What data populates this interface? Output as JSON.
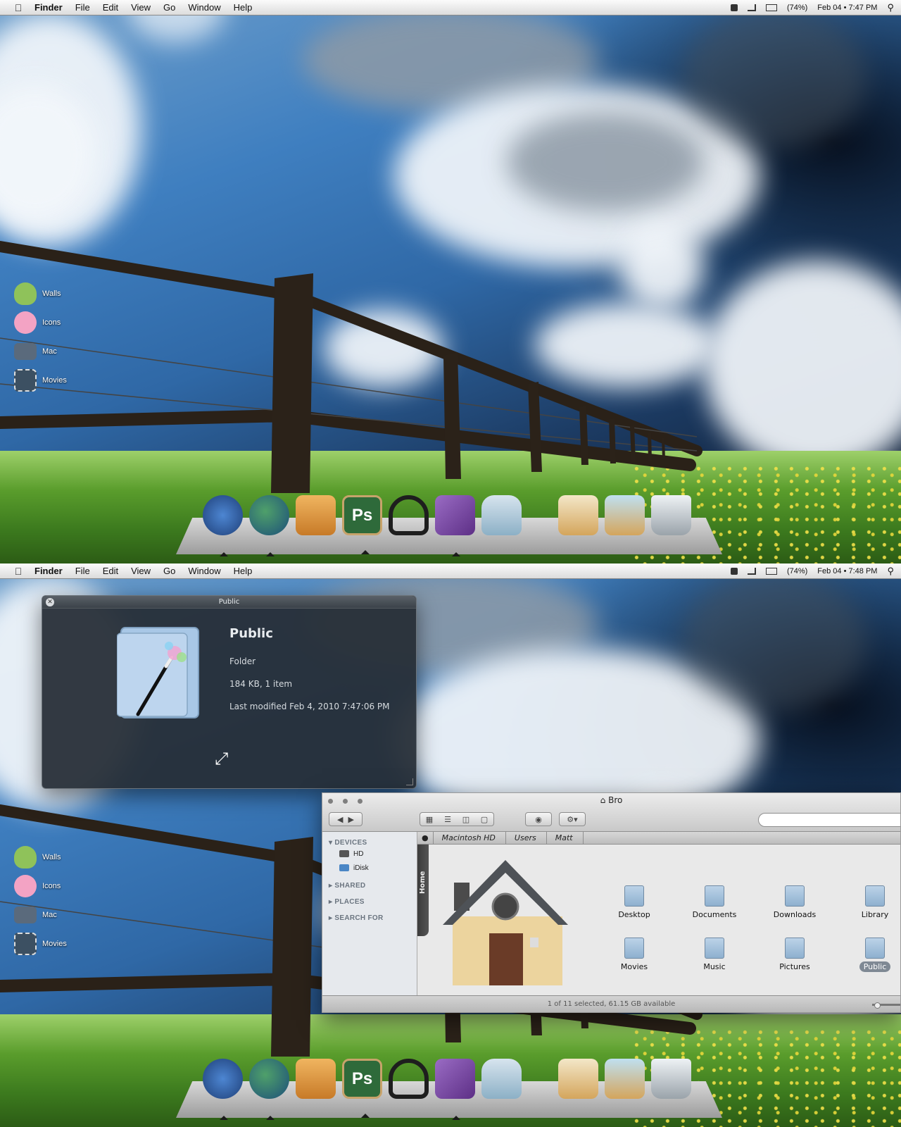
{
  "menubar": {
    "apple_glyph": "",
    "app": "Finder",
    "items": [
      "File",
      "Edit",
      "View",
      "Go",
      "Window",
      "Help"
    ],
    "battery": "(74%)",
    "clock_top": "Feb 04 • 7:47 PM",
    "clock_bottom": "Feb 04 • 7:48 PM"
  },
  "desktop_icons": [
    {
      "label": "Walls",
      "color": "#8fc25a"
    },
    {
      "label": "Icons",
      "color": "#f3a3c4"
    },
    {
      "label": "Mac",
      "color": "#5a6a7c"
    },
    {
      "label": "Movies",
      "color": "#3c5062"
    }
  ],
  "dock": {
    "items": [
      {
        "name": "radar-icon",
        "glyph": "",
        "color": "#2f5fa8",
        "running": true
      },
      {
        "name": "globe-icon",
        "glyph": "",
        "color": "#2f7d4a",
        "running": true
      },
      {
        "name": "ichat-icon",
        "glyph": "",
        "color": "#d98a32",
        "running": false
      },
      {
        "name": "photoshop-icon",
        "glyph": "Ps",
        "color": "#2e6a3a",
        "running": true
      },
      {
        "name": "headphones-icon",
        "glyph": "",
        "color": "#1e1e1e",
        "running": false
      },
      {
        "name": "milka-icon",
        "glyph": "",
        "color": "#7d4ea2",
        "running": true
      },
      {
        "name": "jar-icon",
        "glyph": "",
        "color": "#8cb0c6",
        "running": false
      },
      {
        "name": "box-icon",
        "glyph": "",
        "color": "#d4a55c",
        "running": false
      },
      {
        "name": "box-icon-2",
        "glyph": "",
        "color": "#d4a55c",
        "running": false
      },
      {
        "name": "trash-icon",
        "glyph": "",
        "color": "#bfc6cc",
        "running": false
      }
    ]
  },
  "quicklook": {
    "title": "Public",
    "name": "Public",
    "kind": "Folder",
    "size": "184 KB, 1 item",
    "modified": "Last modified Feb 4, 2010 7:47:06 PM"
  },
  "finder": {
    "title": "Bro",
    "sidebar": {
      "devices_label": "DEVICES",
      "devices": [
        "HD",
        "iDisk"
      ],
      "shared_label": "SHARED",
      "places_label": "PLACES",
      "search_label": "SEARCH FOR"
    },
    "path": [
      "Macintosh HD",
      "Users",
      "Matt"
    ],
    "home_tab": "Home",
    "items": [
      {
        "label": "Desktop"
      },
      {
        "label": "Documents"
      },
      {
        "label": "Downloads"
      },
      {
        "label": "Library"
      },
      {
        "label": "Movies"
      },
      {
        "label": "Music"
      },
      {
        "label": "Pictures"
      },
      {
        "label": "Public",
        "selected": true
      }
    ],
    "status": "1 of 11 selected, 61.15 GB available",
    "search_placeholder": ""
  }
}
